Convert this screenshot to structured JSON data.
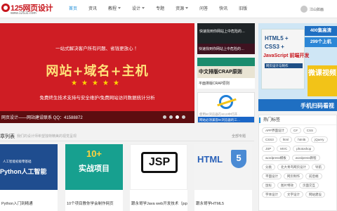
{
  "header": {
    "logo_name": "125网页设计",
    "logo_url": "www.125JZ.com",
    "nav": [
      {
        "label": "首页",
        "active": true,
        "dropdown": false
      },
      {
        "label": "资讯",
        "active": false,
        "dropdown": false
      },
      {
        "label": "教程",
        "active": false,
        "dropdown": true
      },
      {
        "label": "设计",
        "active": false,
        "dropdown": true
      },
      {
        "label": "专题",
        "active": false,
        "dropdown": false
      },
      {
        "label": "资源",
        "active": false,
        "dropdown": true
      },
      {
        "label": "问答",
        "active": false,
        "dropdown": false
      },
      {
        "label": "快讯",
        "active": false,
        "dropdown": false
      },
      {
        "label": "旧版",
        "active": false,
        "dropdown": false
      }
    ],
    "user_name": "江山如画"
  },
  "slider": {
    "subtitle": "一站式解决客户所有问题、省钱更放心 ！",
    "title": "网站+域名+主机",
    "stars": "★★★★★",
    "footer": "免费终生技术支持与安全维护/免费网站访问数据统计分析",
    "caption": "网页设计——网站建设联系 QQ：41588872",
    "dots": [
      false,
      false,
      true,
      false
    ]
  },
  "promos": [
    {
      "text": "快速找到你网站上中危险的…",
      "bottom": "快速找到你网站上中危险的…"
    },
    {
      "text": "中文排版CRAP原则",
      "bottom": "平面排版CRAP原则"
    },
    {
      "text": "使用IE浏览器在IE10中打开…",
      "bottom": "网站必须兼容IE浏览器的三…"
    }
  ],
  "book_ad": {
    "title1": "HTML5 +",
    "title2": "CSS3 +",
    "title3": "JavaScript 前端开发",
    "subtitle": "网页设计与制作",
    "badge1": "400集高清",
    "badge2": "299个上机",
    "video": "微课视频",
    "scan": "手机扫码看视"
  },
  "hot_tags": {
    "title": "热门标签",
    "tags": [
      "APP界面设计",
      "C#",
      "CSS",
      "CSS3",
      "html",
      "html5",
      "jQuery",
      "JSP",
      "MVC",
      "photoshop",
      "wordpress模板",
      "wordpress教程",
      "分类",
      "北大青鸟网页设计",
      "导航",
      "平面设计",
      "网页制作",
      "前后端",
      "鼠标",
      "图片特效",
      "页面交互",
      "字体设计",
      "文字设计",
      "网站建设"
    ]
  },
  "article_list": {
    "title": "章列表",
    "description": "我们的设计师希望独特精美的视觉呈现",
    "all_label": "全部专题",
    "items": [
      {
        "title": "Python入门到精通",
        "thumb_small": "人工智能初级零基础",
        "thumb_big": "Python人工智能"
      },
      {
        "title": "10个项目教你学会制作网页",
        "thumb_num": "10+",
        "thumb_big": "实战项目"
      },
      {
        "title": "跟永哥学Java web开发技术（jsp…",
        "thumb_big": "JSP"
      },
      {
        "title": "跟永哥学HTML5",
        "thumb_big": "HTML",
        "thumb_num": "5"
      }
    ]
  }
}
